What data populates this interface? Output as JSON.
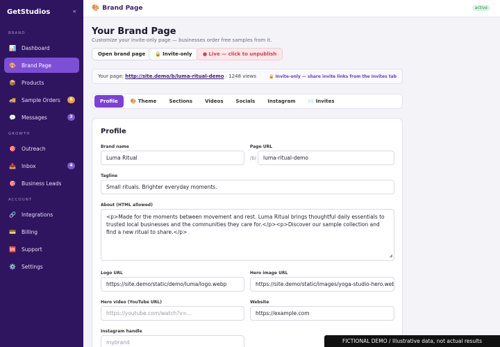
{
  "app": {
    "name": "GetStudios",
    "collapse_glyph": "«"
  },
  "sidebar": {
    "sections": [
      {
        "label": "BRAND"
      },
      {
        "label": "GROWTH"
      },
      {
        "label": "ACCOUNT"
      }
    ],
    "items": [
      {
        "label": "Dashboard",
        "icon": "chart-icon"
      },
      {
        "label": "Brand Page",
        "icon": "palette-icon",
        "active": true
      },
      {
        "label": "Products",
        "icon": "box-icon"
      },
      {
        "label": "Sample Orders",
        "icon": "truck-icon",
        "badge": "6"
      },
      {
        "label": "Messages",
        "icon": "chat-icon",
        "badge": "3"
      },
      {
        "label": "Outreach",
        "icon": "target-icon"
      },
      {
        "label": "Inbox",
        "icon": "inbox-icon",
        "badge": "4"
      },
      {
        "label": "Business Leads",
        "icon": "target-icon"
      },
      {
        "label": "Integrations",
        "icon": "link-icon"
      },
      {
        "label": "Billing",
        "icon": "card-icon"
      },
      {
        "label": "Support",
        "icon": "sos-icon"
      },
      {
        "label": "Settings",
        "icon": "gear-icon"
      }
    ]
  },
  "topbar": {
    "icon": "🎨",
    "title": "Brand Page",
    "status": "active"
  },
  "header": {
    "title": "Your Brand Page",
    "subtitle": "Customize your invite-only page — businesses order free samples from it."
  },
  "actions": {
    "open": "Open brand page",
    "invite_only": "🔒 Invite-only",
    "live": "● Live — click to unpublish"
  },
  "infobar": {
    "prefix": "Your page:",
    "url": "http://site.demo/b/luma-ritual-demo",
    "views": "· 1248 views",
    "hint": "🔒 Invite-only — share invite links from the Invites tab"
  },
  "tabs": [
    {
      "label": "Profile",
      "active": true
    },
    {
      "label": "🎨 Theme"
    },
    {
      "label": "Sections"
    },
    {
      "label": "Videos"
    },
    {
      "label": "Socials"
    },
    {
      "label": "Instagram"
    },
    {
      "label": "✉️ Invites"
    }
  ],
  "profile": {
    "title": "Profile",
    "brand_name": {
      "label": "Brand name",
      "value": "Luma Ritual"
    },
    "page_url": {
      "label": "Page URL",
      "prefix": "/b/",
      "value": "luma-ritual-demo"
    },
    "tagline": {
      "label": "Tagline",
      "value": "Small rituals. Brighter everyday moments."
    },
    "about": {
      "label": "About (HTML allowed)",
      "value": "<p>Made for the moments between movement and rest. Luma Ritual brings thoughtful daily essentials to trusted local businesses and the communities they care for.</p><p>Discover our sample collection and find a new ritual to share.</p>"
    },
    "logo_url": {
      "label": "Logo URL",
      "value": "https://site.demo/static/demo/luma/logo.webp"
    },
    "hero_image_url": {
      "label": "Hero image URL",
      "value": "https://site.demo/static/images/yoga-studio-hero.webp"
    },
    "hero_video": {
      "label": "Hero video (YouTube URL)",
      "placeholder": "https://youtube.com/watch?v=..."
    },
    "website": {
      "label": "Website",
      "value": "https://example.com"
    },
    "instagram": {
      "label": "Instagram handle",
      "placeholder": "mybrand"
    }
  },
  "banner": "FICTIONAL DEMO  /  Illustrative data, not actual results",
  "colors": {
    "sidebar": "#2f1460",
    "accent": "#7c3fd9",
    "live": "#d33a4c"
  }
}
